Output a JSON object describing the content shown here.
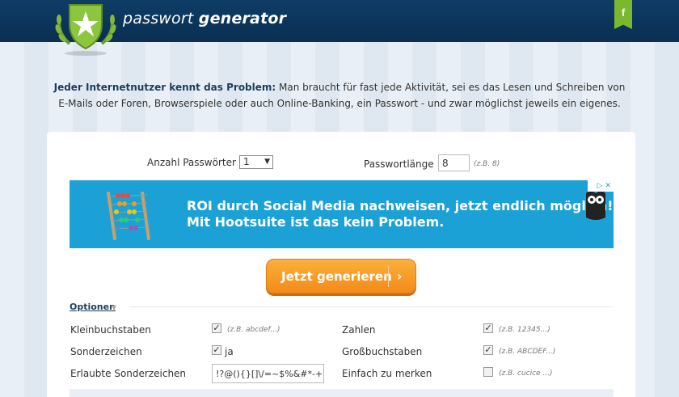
{
  "header": {
    "brand_light": "passwort ",
    "brand_bold": "generator",
    "facebook_label": "f"
  },
  "intro": {
    "lead": "Jeder Internetnutzer kennt das Problem:",
    "text": " Man braucht für fast jede Aktivität, sei es das Lesen und Schreiben von E-Mails oder Foren, Browserspiele oder auch Online-Banking, ein Passwort - und zwar möglichst jeweils ein eigenes."
  },
  "form": {
    "count_label": "Anzahl Passwörter",
    "count_value": "1",
    "length_label": "Passwortlänge",
    "length_value": "8",
    "length_hint": "(z.B. 8)"
  },
  "ad": {
    "line1": "ROI durch Social Media nachweisen, jetzt endlich möglich!",
    "line2": "Mit Hootsuite ist das kein Problem.",
    "close": "▷ ✕"
  },
  "generate_button": {
    "label": "Jetzt generieren",
    "chevron": "›"
  },
  "options": {
    "heading": "Optionen",
    "rows": [
      {
        "left_label": "Kleinbuchstaben",
        "left_checked": true,
        "left_hint": "(z.B. abcdef...)",
        "right_label": "Zahlen",
        "right_checked": true,
        "right_hint": "(z.B. 12345...)"
      },
      {
        "left_label": "Sonderzeichen",
        "left_checked": true,
        "left_hint": "ja",
        "right_label": "Großbuchstaben",
        "right_checked": true,
        "right_hint": "(z.B. ABCDEF...)"
      },
      {
        "left_label": "Erlaubte Sonderzeichen",
        "left_value": "!?@(){}[]\\/=~$%&#*-+.,_",
        "right_label": "Einfach zu merken",
        "right_checked": false,
        "right_hint": "(z.B. cucice ...)"
      }
    ]
  },
  "colors": {
    "header_bg": "#0e3c66",
    "accent_orange": "#f48a1a",
    "ad_bg": "#1ca1d6",
    "fb_green": "#7cb82f"
  }
}
